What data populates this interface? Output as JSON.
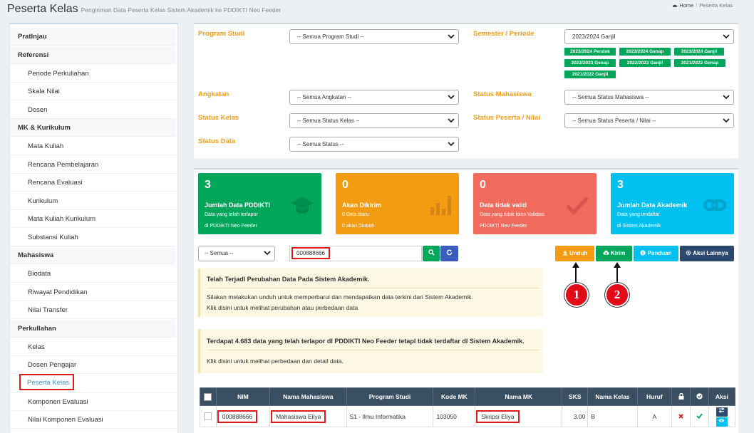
{
  "header": {
    "title": "Peserta Kelas",
    "subtitle": "Pengiriman Data Peserta Kelas Sistem Akademik ke PDDIKTI Neo Feeder",
    "breadcrumb_home": "Home",
    "breadcrumb_current": "Peserta Kelas"
  },
  "sidebar": {
    "items": [
      {
        "label": "PratInjau",
        "type": "head"
      },
      {
        "label": "Referensi",
        "type": "head"
      },
      {
        "label": "Periode Perkuliahan",
        "type": "sub"
      },
      {
        "label": "Skala Nilai",
        "type": "sub"
      },
      {
        "label": "Dosen",
        "type": "sub"
      },
      {
        "label": "MK & Kurikulum",
        "type": "head"
      },
      {
        "label": "Mata Kuliah",
        "type": "sub"
      },
      {
        "label": "Rencana Pembelajaran",
        "type": "sub"
      },
      {
        "label": "Rencana Evaluasi",
        "type": "sub"
      },
      {
        "label": "Kurikulum",
        "type": "sub"
      },
      {
        "label": "Mata Kuliah Kurikulum",
        "type": "sub"
      },
      {
        "label": "Substansi Kuliah",
        "type": "sub"
      },
      {
        "label": "Mahasiswa",
        "type": "head"
      },
      {
        "label": "Biodata",
        "type": "sub"
      },
      {
        "label": "Riwayat Pendidikan",
        "type": "sub"
      },
      {
        "label": "Nilai Transfer",
        "type": "sub"
      },
      {
        "label": "Perkullahan",
        "type": "head"
      },
      {
        "label": "Kelas",
        "type": "sub"
      },
      {
        "label": "Dosen Pengajar",
        "type": "sub"
      },
      {
        "label": "Peserta Kelas",
        "type": "active"
      },
      {
        "label": "Komponen Evaluasi",
        "type": "sub"
      },
      {
        "label": "Nilai Komponen Evaluasi",
        "type": "sub"
      }
    ]
  },
  "filters": {
    "program_studi_label": "Program Studi",
    "program_studi_value": "-- Semua Program Studi --",
    "semester_label": "Semester / Periode",
    "semester_value": "2023/2024 Ganjil",
    "semester_tags": [
      "2023/2024 Pendek",
      "2023/2024 Genap",
      "2023/2024 Ganjil",
      "2022/2023 Genap",
      "2022/2023 Ganjil",
      "2021/2022 Genap",
      "2021/2022 Ganjil"
    ],
    "angkatan_label": "Angkatan",
    "angkatan_value": "-- Semua Angkatan --",
    "status_mahasiswa_label": "Status Mahasiswa",
    "status_mahasiswa_value": "-- Semua Status Mahasiswa --",
    "status_kelas_label": "Status Kelas",
    "status_kelas_value": "-- Semua Status Kelas --",
    "status_peserta_label": "Status Peserta / Nilai",
    "status_peserta_value": "-- Semua Status Peserta / Nilai --",
    "status_data_label": "Status Data",
    "status_data_value": "-- Semua Status --"
  },
  "cards": [
    {
      "num": "3",
      "title": "Jumlah Data PDDIKTI",
      "line1": "Data yang telah terlapor",
      "line2": "di PDDIKTI Neo Feeder",
      "color": "#00a65a",
      "icon": "graduation-cap-icon"
    },
    {
      "num": "0",
      "title": "Akan Dikirim",
      "line1": "0 Data Baru",
      "line2": "0 akan Diubah",
      "color": "#f39c12",
      "icon": "bar-chart-icon"
    },
    {
      "num": "0",
      "title": "Data tidak valid",
      "line1": "Data yang tidak lolos Validasi",
      "line2": "PDDIKTI Neo Feeder",
      "color": "#dd4b39",
      "icon": "check-icon"
    },
    {
      "num": "3",
      "title": "Jumlah Data Akademik",
      "line1": "Data yang terdaftar",
      "line2": "di Sistem Akademik",
      "color": "#00c0ef",
      "icon": "link-icon"
    }
  ],
  "toolbar": {
    "filter_value": "-- Semua --",
    "search_value": "000888666",
    "unduh_label": "Unduh",
    "kirim_label": "Kirim",
    "panduan_label": "Panduan",
    "aksi_label": "Aksi Lainnya"
  },
  "badges": [
    "1",
    "2"
  ],
  "notice1": {
    "title": "Telah TerjadI Perubahan Data Pada Sistem Akademik.",
    "line1": "Silakan melakukan unduh untuk memperbarui dan mendapatkan data terkini dari Sistem Akademik.",
    "line2": "Klik disini untuk melihat perubahan atau perbedaan data"
  },
  "notice2": {
    "title": "Terdapat 4.683 data yang telah terlapor dI PDDIKTI Neo Feeder tetapI tidak terdaftar dI Sistem Akademik.",
    "line1": "Klik disini untuk melihat perbedaan dan detail data."
  },
  "table": {
    "headers": [
      "NIM",
      "Nama Mahasiswa",
      "Program Studi",
      "Kode MK",
      "Nama MK",
      "SKS",
      "Nama Kelas",
      "Huruf",
      "Aksi"
    ],
    "rows": [
      {
        "nim": "000888666",
        "nama": "Mahasiswa Eliya",
        "prodi": "S1 - Ilmu Informatika",
        "kode": "103050",
        "mk": "Skripsi Eliya",
        "sks": "3.00",
        "kelas": "B",
        "huruf": "A"
      }
    ]
  },
  "colors": {
    "orange": "#f39c12",
    "green": "#00a65a",
    "cyan": "#00c0ef",
    "navy": "#3b4f63",
    "red": "#e30b17"
  }
}
